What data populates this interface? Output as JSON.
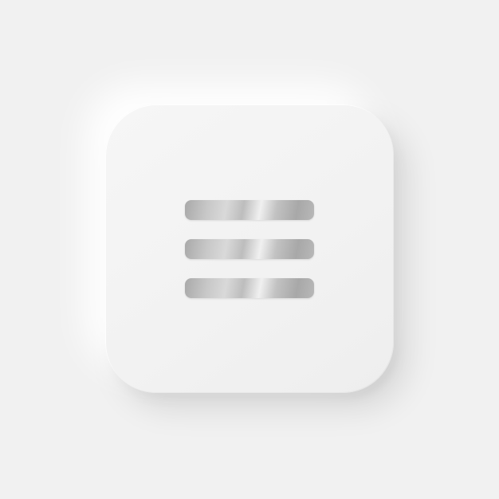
{
  "menu_button": {
    "icon": "hamburger-menu-icon",
    "bar_count": 3
  },
  "colors": {
    "background": "#f1f1f1",
    "button_surface": "#f3f3f3",
    "bar_metal_dark": "#a9a9a9",
    "bar_metal_light": "#f0f0f0"
  }
}
